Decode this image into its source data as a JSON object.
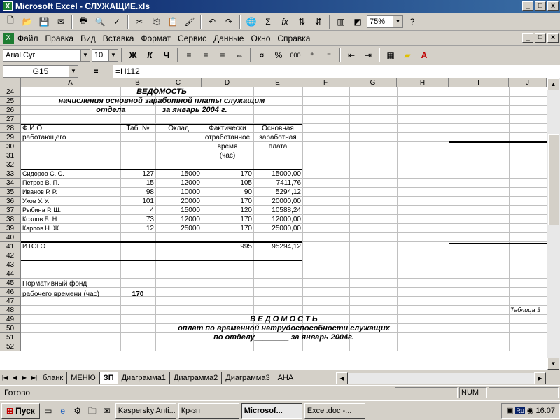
{
  "window": {
    "title": "Microsoft Excel - СЛУЖАЩИЕ.xls",
    "min": "_",
    "max": "□",
    "close": "x"
  },
  "toolbar1": {
    "zoom": "75%",
    "help": "?"
  },
  "menu": [
    "Файл",
    "Правка",
    "Вид",
    "Вставка",
    "Формат",
    "Сервис",
    "Данные",
    "Окно",
    "Справка"
  ],
  "toolbar2": {
    "font": "Arial Cyr",
    "size": "10",
    "bold": "Ж",
    "italic": "К",
    "underline": "Ч",
    "percent": "%",
    "thousands": "000"
  },
  "formula": {
    "cell": "G15",
    "eq": "=",
    "value": "=H112"
  },
  "columns": [
    "A",
    "B",
    "C",
    "D",
    "E",
    "F",
    "G",
    "H",
    "I",
    "J"
  ],
  "rows": [
    "24",
    "25",
    "26",
    "27",
    "28",
    "29",
    "30",
    "31",
    "32",
    "33",
    "34",
    "35",
    "36",
    "37",
    "38",
    "39",
    "40",
    "41",
    "42",
    "43",
    "44",
    "45",
    "46",
    "47",
    "48",
    "49",
    "50",
    "51",
    "52"
  ],
  "sheet": {
    "title1": "ВЕДОМОСТЬ",
    "title2": "начисления основной заработной платы служащим",
    "title3": "отдела ________за январь 2004 г.",
    "h_fio1": "Ф.И.О.",
    "h_fio2": "работающего",
    "h_tab": "Таб. №",
    "h_oklad": "Оклад",
    "h_fact1": "Фактически",
    "h_fact2": "отработанное",
    "h_fact3": "время",
    "h_fact4": "(час)",
    "h_pay1": "Основная",
    "h_pay2": "заработная",
    "h_pay3": "плата",
    "employees": [
      {
        "name": "Сидоров С. С.",
        "tab": "127",
        "oklad": "15000",
        "hours": "170",
        "pay": "15000,00"
      },
      {
        "name": "Петров В. П.",
        "tab": "15",
        "oklad": "12000",
        "hours": "105",
        "pay": "7411,76"
      },
      {
        "name": "Иванов Р. Р.",
        "tab": "98",
        "oklad": "10000",
        "hours": "90",
        "pay": "5294,12"
      },
      {
        "name": "Ухов У. У.",
        "tab": "101",
        "oklad": "20000",
        "hours": "170",
        "pay": "20000,00"
      },
      {
        "name": "Рыбина Р. Ш.",
        "tab": "4",
        "oklad": "15000",
        "hours": "120",
        "pay": "10588,24"
      },
      {
        "name": "Козлов Б. Н.",
        "tab": "73",
        "oklad": "12000",
        "hours": "170",
        "pay": "12000,00"
      },
      {
        "name": "Карпов Н. Ж.",
        "tab": "12",
        "oklad": "25000",
        "hours": "170",
        "pay": "25000,00"
      }
    ],
    "total_label": "ИТОГО",
    "total_hours": "995",
    "total_pay": "95294,12",
    "norm1": "Нормативный фонд",
    "norm2": "рабочего времени (час)",
    "norm_value": "170",
    "table3": "Таблица 3",
    "title4": "В Е Д О М О С Т Ь",
    "title5": "оплат по временной нетрудоспособности служащих",
    "title6": "по отделу________ за январь 2004г."
  },
  "tabs": [
    "бланк",
    "МЕНЮ",
    "ЗП",
    "Диаграмма1",
    "Диаграмма2",
    "Диаграмма3",
    "АНА"
  ],
  "status": {
    "ready": "Готово",
    "num": "NUM"
  },
  "taskbar": {
    "start": "Пуск",
    "items": [
      "Kaspersky Anti...",
      "Кр-зп",
      "Microsof...",
      "Excel.doc -..."
    ],
    "lang": "Ru",
    "time": "16:07"
  }
}
